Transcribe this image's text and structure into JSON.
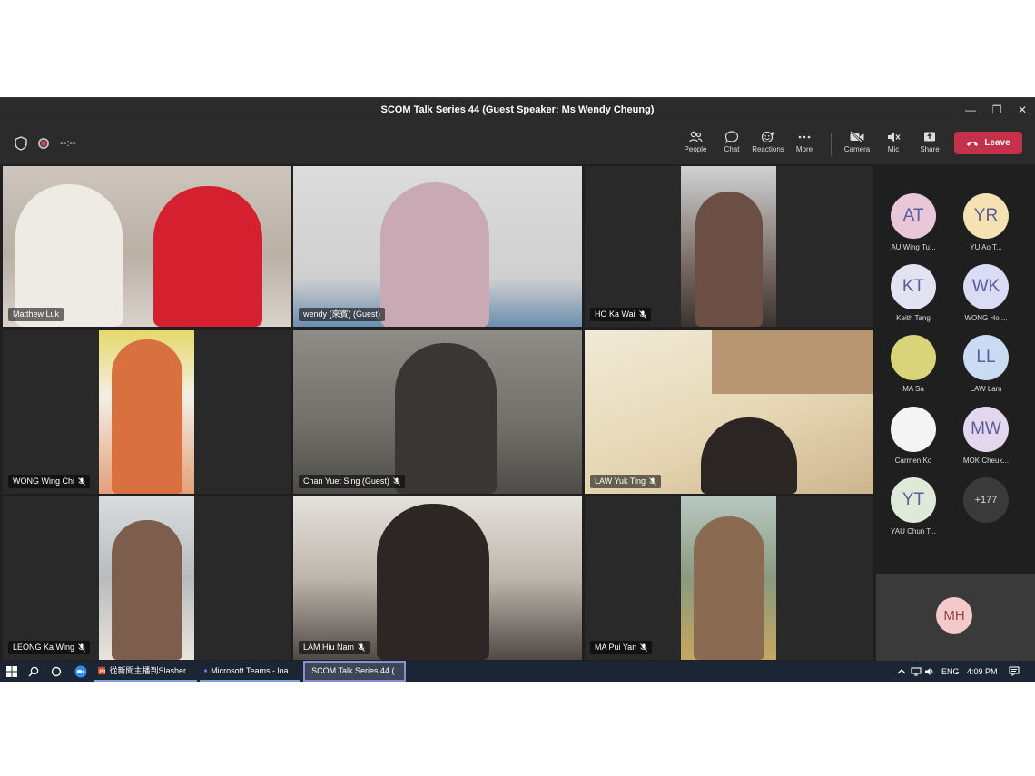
{
  "window": {
    "title": "SCOM Talk Series 44 (Guest Speaker: Ms Wendy Cheung)",
    "controls": [
      "—",
      "❐",
      "✕"
    ]
  },
  "toolbar": {
    "timer": "--:--",
    "people": "People",
    "chat": "Chat",
    "reactions": "Reactions",
    "more": "More",
    "camera": "Camera",
    "mic": "Mic",
    "share": "Share",
    "leave": "Leave"
  },
  "tiles": [
    {
      "name": "Matthew Luk",
      "mic": false
    },
    {
      "name": "wendy (來賓) (Guest)",
      "mic": false
    },
    {
      "name": "HO Ka Wai",
      "mic": true
    },
    {
      "name": "WONG Wing Chi",
      "mic": true
    },
    {
      "name": "Chan Yuet Sing (Guest)",
      "mic": true
    },
    {
      "name": "LAW Yuk Ting",
      "mic": true
    },
    {
      "name": "LEONG Ka Wing",
      "mic": true
    },
    {
      "name": "LAM Hiu Nam",
      "mic": true
    },
    {
      "name": "MA Pui Yan",
      "mic": true
    }
  ],
  "roster": [
    {
      "initials": "AT",
      "label": "AU Wing Tu...",
      "color": "#e8c7d9"
    },
    {
      "initials": "YR",
      "label": "YU Ao T...",
      "color": "#f4e2b3"
    },
    {
      "initials": "KT",
      "label": "Keith Tang",
      "color": "#e2e2f2"
    },
    {
      "initials": "WK",
      "label": "WONG Ho ...",
      "color": "#dadbf4"
    },
    {
      "initials": "",
      "label": "MA Sa",
      "color": "#d9d37a"
    },
    {
      "initials": "LL",
      "label": "LAW Lam",
      "color": "#c9dcf3"
    },
    {
      "initials": "",
      "label": "Carmen Ko",
      "color": "#f4f4f4"
    },
    {
      "initials": "MW",
      "label": "MOK Cheuk...",
      "color": "#e3d7ef"
    },
    {
      "initials": "YT",
      "label": "YAU Chun T...",
      "color": "#dfe9d9"
    },
    {
      "initials": "+177",
      "label": "",
      "color": "#3a3a3a"
    }
  ],
  "self_view": {
    "initials": "MH"
  },
  "taskbar": {
    "items": [
      "從新聞主播到Slasher...",
      "Microsoft Teams - loa...",
      "SCOM Talk Series 44 (..."
    ],
    "lang": "ENG",
    "time": "4:09 PM"
  }
}
